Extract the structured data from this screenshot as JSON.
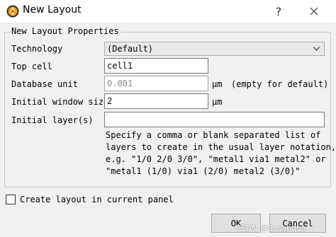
{
  "window": {
    "title": "New Layout",
    "help_glyph": "?",
    "app_icon": "klayout-icon",
    "close_icon": "close-icon"
  },
  "group": {
    "title": "New Layout Properties"
  },
  "fields": {
    "technology": {
      "label": "Technology",
      "value": "(Default)"
    },
    "top_cell": {
      "label": "Top cell",
      "value": "cell1"
    },
    "database_unit": {
      "label": "Database unit",
      "placeholder": "0.001",
      "unit": "μm",
      "hint": "(empty for default)"
    },
    "initial_window_size": {
      "label": "Initial window size",
      "value": "2",
      "unit": "μm"
    },
    "initial_layers": {
      "label": "Initial layer(s)",
      "value": "",
      "help": "Specify a comma or blank separated list of\nlayers to create in the usual layer notation,\ne.g. \"1/0 2/0 3/0\", \"metal1 via1 metal2\" or\n\"metal1 (1/0) via1 (2/0) metal2 (3/0)\""
    }
  },
  "options": {
    "create_in_current_panel": {
      "label": "Create layout in current panel",
      "checked": false
    }
  },
  "buttons": {
    "ok": "OK",
    "cancel": "Cancel"
  },
  "watermark": "CSDN @Sasanqua",
  "colors": {
    "dialog_bg": "#f0f0f0",
    "titlebar_bg": "#ffffff",
    "placeholder": "#8a8a8a"
  }
}
